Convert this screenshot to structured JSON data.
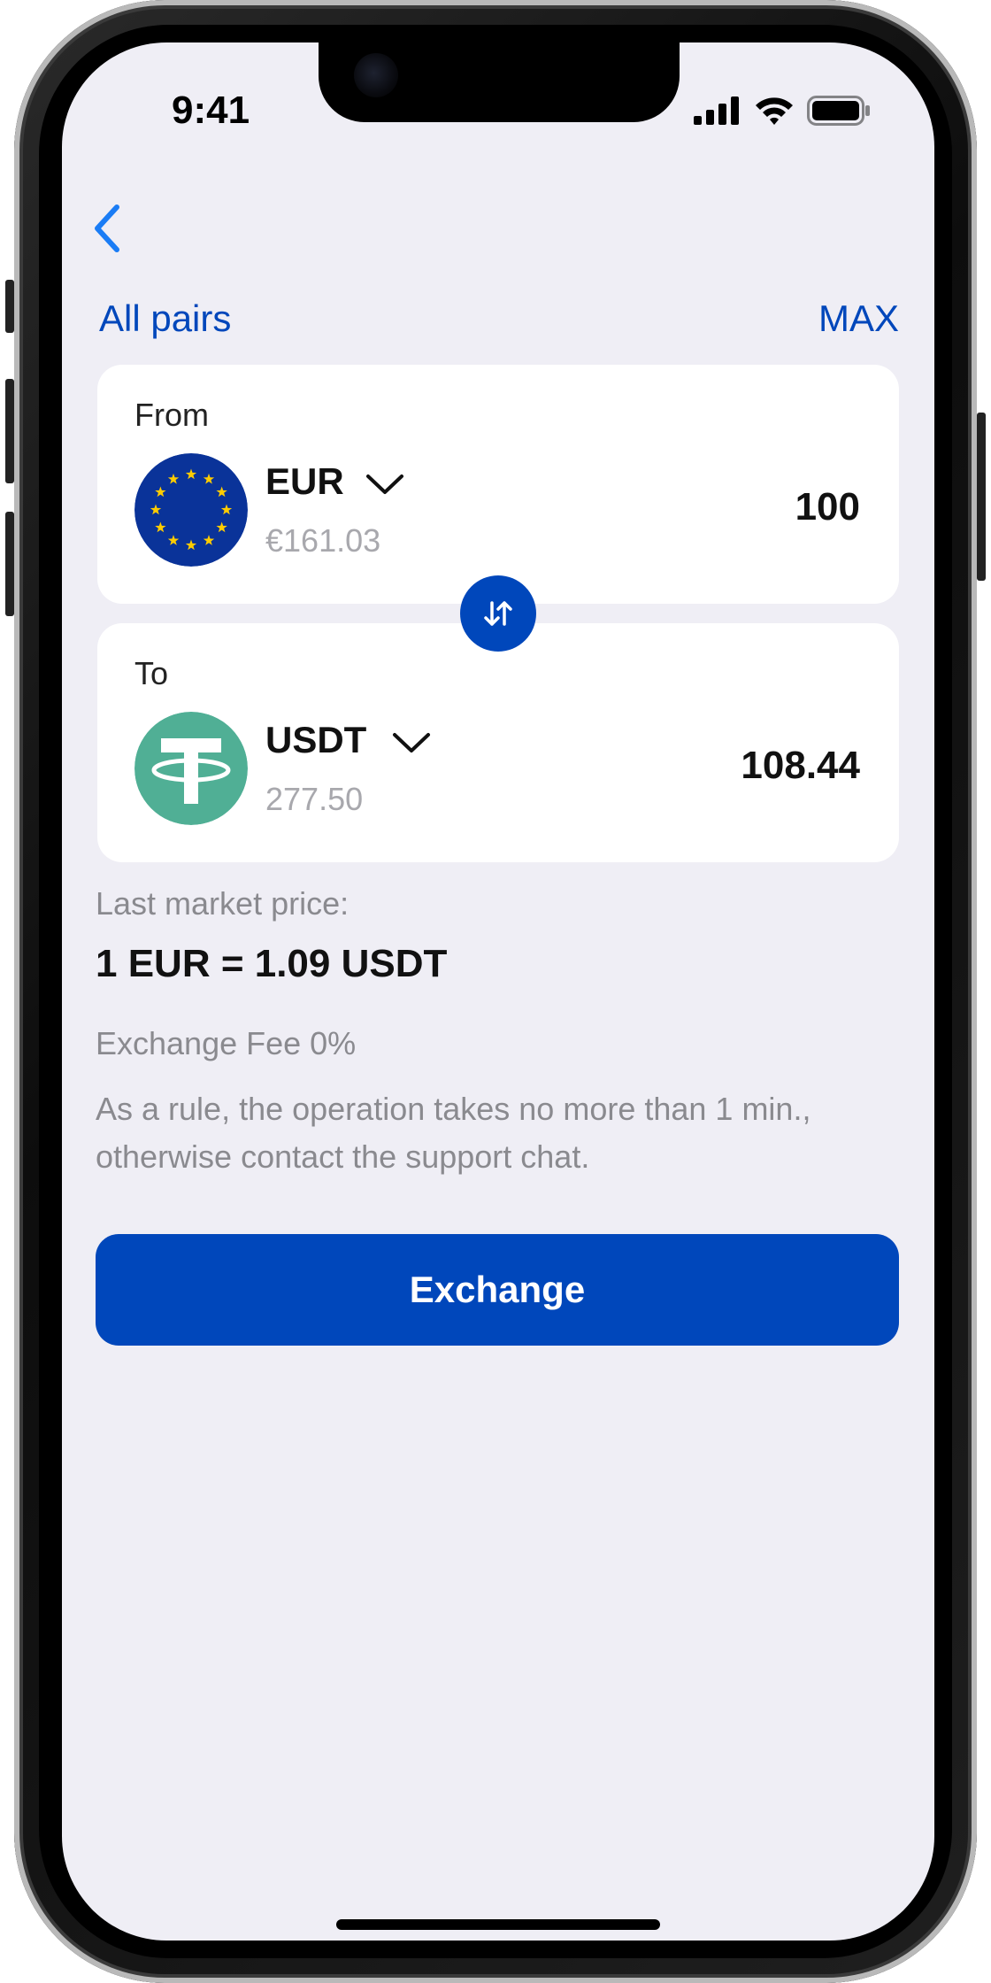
{
  "status_bar": {
    "time": "9:41",
    "icons": [
      "cellular-signal-icon",
      "wifi-icon",
      "battery-icon"
    ]
  },
  "nav": {
    "back_icon": "chevron-left-icon",
    "all_pairs_label": "All pairs",
    "max_label": "MAX"
  },
  "from_card": {
    "label": "From",
    "currency": "EUR",
    "balance": "€161.03",
    "amount": "100",
    "icon": "eu-flag-icon"
  },
  "to_card": {
    "label": "To",
    "currency": "USDT",
    "balance": "277.50",
    "amount": "108.44",
    "icon": "tether-icon"
  },
  "swap_icon": "swap-arrows-icon",
  "market": {
    "label": "Last market price:",
    "rate": "1 EUR = 1.09 USDT",
    "fee": "Exchange Fee 0%",
    "note": "As a rule, the operation takes no more than 1 min., otherwise contact the support chat."
  },
  "exchange_button_label": "Exchange",
  "colors": {
    "accent": "#0047bb",
    "screen_bg": "#efeef5",
    "card_bg": "#ffffff",
    "muted_text": "#8a8a8f",
    "eu_blue": "#0a3399",
    "eu_gold": "#ffcc00",
    "tether_green": "#50af95"
  }
}
